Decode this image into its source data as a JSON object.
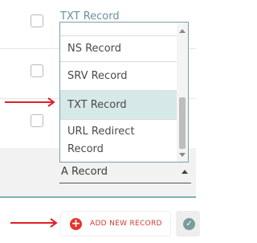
{
  "table": {
    "top_row_label": "TXT Record"
  },
  "record_type_dropdown": {
    "items": [
      "NS Record",
      "SRV Record",
      "TXT Record",
      "URL Redirect Record"
    ],
    "highlighted": "TXT Record",
    "selected_value": "A Record"
  },
  "actions": {
    "add_new_record_label": "ADD NEW RECORD",
    "add_icon": "plus-circle-icon",
    "confirm_icon": "check-circle-icon"
  },
  "annotations": {
    "arrow_color": "#e0202a"
  },
  "colors": {
    "selection_bg": "#d7e8e9",
    "accent_line": "#7bb3b3",
    "add_button_red": "#e5342b"
  }
}
